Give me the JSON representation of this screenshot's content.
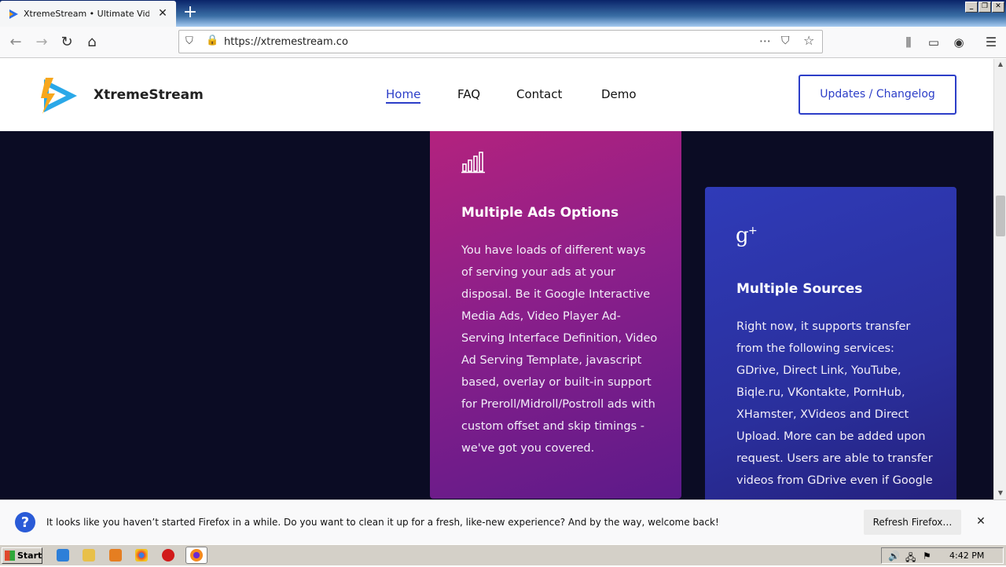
{
  "browser": {
    "tab_title": "XtremeStream • Ultimate Video Str",
    "url": "https://xtremestream.co"
  },
  "site": {
    "brand": "XtremeStream",
    "nav": [
      "Home",
      "FAQ",
      "Contact",
      "Demo"
    ],
    "active_nav": "Home",
    "updates_button": "Updates / Changelog",
    "accent_color": "#2c3ec8"
  },
  "cards": [
    {
      "icon": "bar-chart-icon",
      "title": "Multiple Ads Options",
      "body_lines": [
        "You have loads of different ways",
        "of serving your ads at your",
        "disposal. Be it Google Interactive",
        "Media Ads, Video Player Ad-",
        "Serving Interface Definition, Video",
        "Ad Serving Template, javascript",
        "based, overlay or built-in support",
        "for Preroll/Midroll/Postroll ads with",
        "custom offset and skip timings -",
        "we've got you covered."
      ]
    },
    {
      "icon": "google-plus-icon",
      "title": "Multiple Sources",
      "body_lines": [
        "Right now, it supports transfer",
        "from the following services:",
        "GDrive, Direct Link, YouTube,",
        "Biqle.ru, VKontakte, PornHub,",
        "XHamster, XVideos and Direct",
        "Upload. More can be added upon",
        "request. Users are able to transfer",
        "videos from GDrive even if Google"
      ]
    }
  ],
  "notification": {
    "message": "It looks like you haven’t started Firefox in a while. Do you want to clean it up for a fresh, like-new experience? And by the way, welcome back!",
    "button": "Refresh Firefox…"
  },
  "taskbar": {
    "start": "Start",
    "clock": "4:42 PM"
  }
}
